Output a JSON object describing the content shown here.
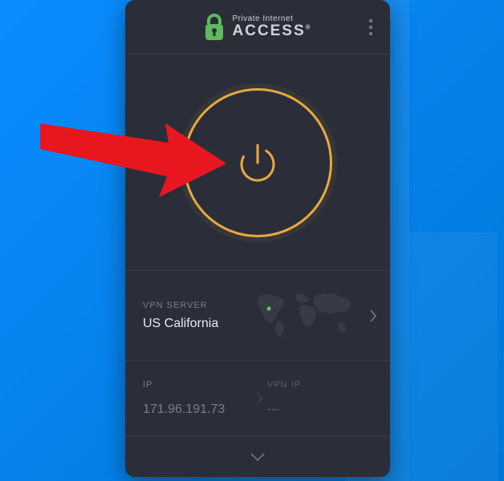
{
  "brand": {
    "line1": "Private Internet",
    "line2": "ACCESS",
    "trademark": "®"
  },
  "server": {
    "label": "VPN SERVER",
    "name": "US California"
  },
  "ip": {
    "label": "IP",
    "value": "171.96.191.73"
  },
  "vpn_ip": {
    "label": "VPN IP",
    "value": "---"
  },
  "colors": {
    "accent": "#e8a93d",
    "connected_dot": "#5edc5e"
  }
}
